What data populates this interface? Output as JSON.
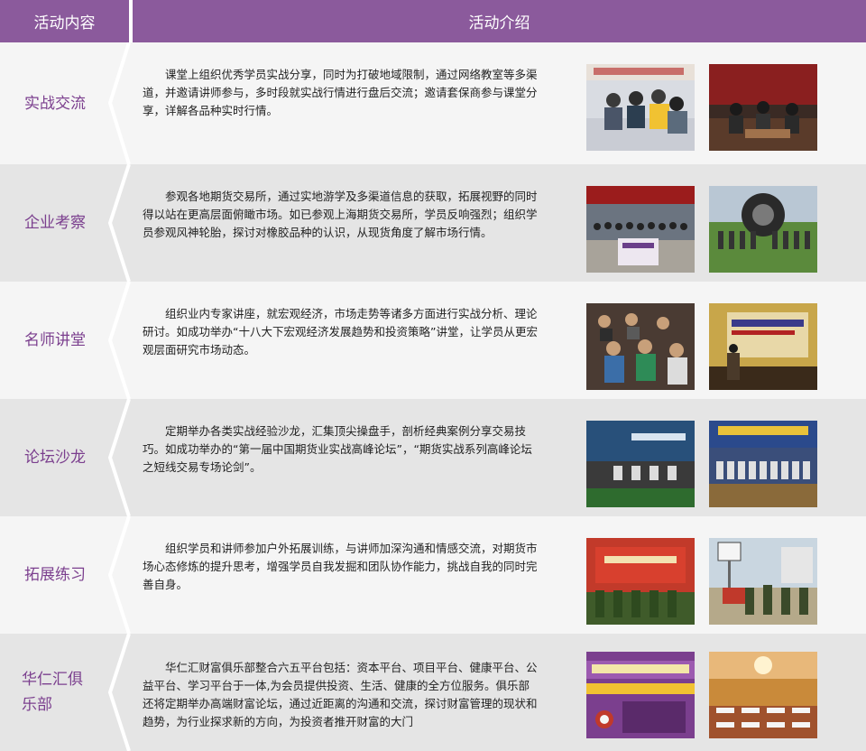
{
  "header": {
    "col1": "活动内容",
    "col2": "活动介绍"
  },
  "rows": [
    {
      "title": "实战交流",
      "text": "课堂上组织优秀学员实战分享，同时为打破地域限制，通过网络教室等多渠道，并邀请讲师参与，多时段就实战行情进行盘后交流；邀请套保商参与课堂分享，详解各品种实时行情。"
    },
    {
      "title": "企业考察",
      "text": "参观各地期货交易所，通过实地游学及多渠道信息的获取，拓展视野的同时得以站在更高层面俯瞰市场。如已参观上海期货交易所，学员反响强烈；组织学员参观风神轮胎，探讨对橡胶品种的认识，从现货角度了解市场行情。"
    },
    {
      "title": "名师讲堂",
      "text": "组织业内专家讲座，就宏观经济，市场走势等诸多方面进行实战分析、理论研讨。如成功举办“十八大下宏观经济发展趋势和投资策略”讲堂，让学员从更宏观层面研究市场动态。"
    },
    {
      "title": "论坛沙龙",
      "text": "定期举办各类实战经验沙龙，汇集顶尖操盘手，剖析经典案例分享交易技巧。如成功举办的“第一届中国期货业实战高峰论坛”，“期货实战系列高峰论坛之短线交易专场论剑”。"
    },
    {
      "title": "拓展练习",
      "text": "组织学员和讲师参加户外拓展训练，与讲师加深沟通和情感交流，对期货市场心态修炼的提升思考，增强学员自我发掘和团队协作能力，挑战自我的同时完善自身。"
    },
    {
      "title": "华仁汇俱乐部",
      "text": "华仁汇财富俱乐部整合六五平台包括：资本平台、项目平台、健康平台、公益平台、学习平台于一体,为会员提供投资、生活、健康的全方位服务。俱乐部还将定期举办高端财富论坛，通过近距离的沟通和交流，探讨财富管理的现状和趋势，为行业探求新的方向，为投资者推开财富的大门"
    }
  ],
  "colors": {
    "header_bg": "#8b5a9c",
    "title_text": "#7b3f8e",
    "row_light": "#f5f5f5",
    "row_dark": "#e5e5e5"
  }
}
